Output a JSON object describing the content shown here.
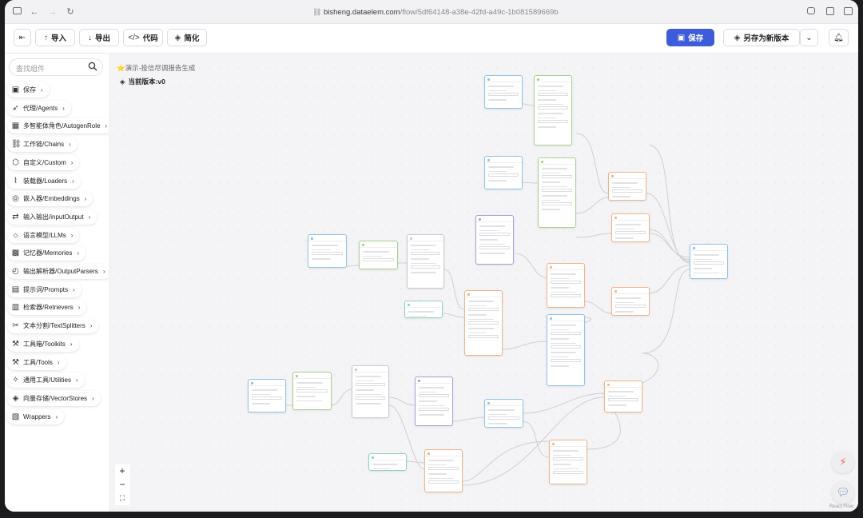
{
  "browser": {
    "url_host": "bisheng.dataelem.com",
    "url_path": "/flow/5df64148-a38e-42fd-a49c-1b081589669b"
  },
  "toolbar": {
    "import_label": "导入",
    "export_label": "导出",
    "code_label": "代码",
    "simplify_label": "简化",
    "save_label": "保存",
    "save_as_label": "另存为新版本"
  },
  "sidebar": {
    "search_placeholder": "查找组件",
    "items": [
      {
        "label": "保存",
        "icon": "save-icon"
      },
      {
        "label": "代理/Agents",
        "icon": "rocket-icon"
      },
      {
        "label": "多智能体角色/AutogenRole",
        "icon": "layout-icon"
      },
      {
        "label": "工作链/Chains",
        "icon": "link-icon"
      },
      {
        "label": "自定义/Custom",
        "icon": "cube-icon"
      },
      {
        "label": "装载器/Loaders",
        "icon": "paperclip-icon"
      },
      {
        "label": "嵌入器/Embeddings",
        "icon": "fingerprint-icon"
      },
      {
        "label": "输入输出/inputOutput",
        "icon": "io-icon"
      },
      {
        "label": "语言模型/LLMs",
        "icon": "lightbulb-icon"
      },
      {
        "label": "记忆器/Memories",
        "icon": "chip-icon"
      },
      {
        "label": "输出解析器/OutputParsers",
        "icon": "compass-icon"
      },
      {
        "label": "提示词/Prompts",
        "icon": "terminal-icon"
      },
      {
        "label": "检索器/Retrievers",
        "icon": "archive-icon"
      },
      {
        "label": "文本分割/TextSplitters",
        "icon": "scissors-icon"
      },
      {
        "label": "工具箱/Toolkits",
        "icon": "wrench-icon"
      },
      {
        "label": "工具/Tools",
        "icon": "hammer-icon"
      },
      {
        "label": "通用工具/Utilities",
        "icon": "wand-icon"
      },
      {
        "label": "向量存储/VectorStores",
        "icon": "layers-icon"
      },
      {
        "label": "Wrappers",
        "icon": "gift-icon"
      }
    ]
  },
  "canvas": {
    "flow_title": "⭐演示-投信尽调报告生成",
    "version_label": "当前版本:v0",
    "react_flow_label": "React Flow"
  },
  "colors": {
    "accent": "#3e5bd9",
    "node_blue": "#8fc3e8",
    "node_green": "#a9d08e",
    "node_purple": "#a9a0d6",
    "node_orange": "#f0b48a",
    "node_teal": "#8ed3c0",
    "fab_orange": "#f26b3a",
    "fab_blue": "#6f8fbf"
  }
}
